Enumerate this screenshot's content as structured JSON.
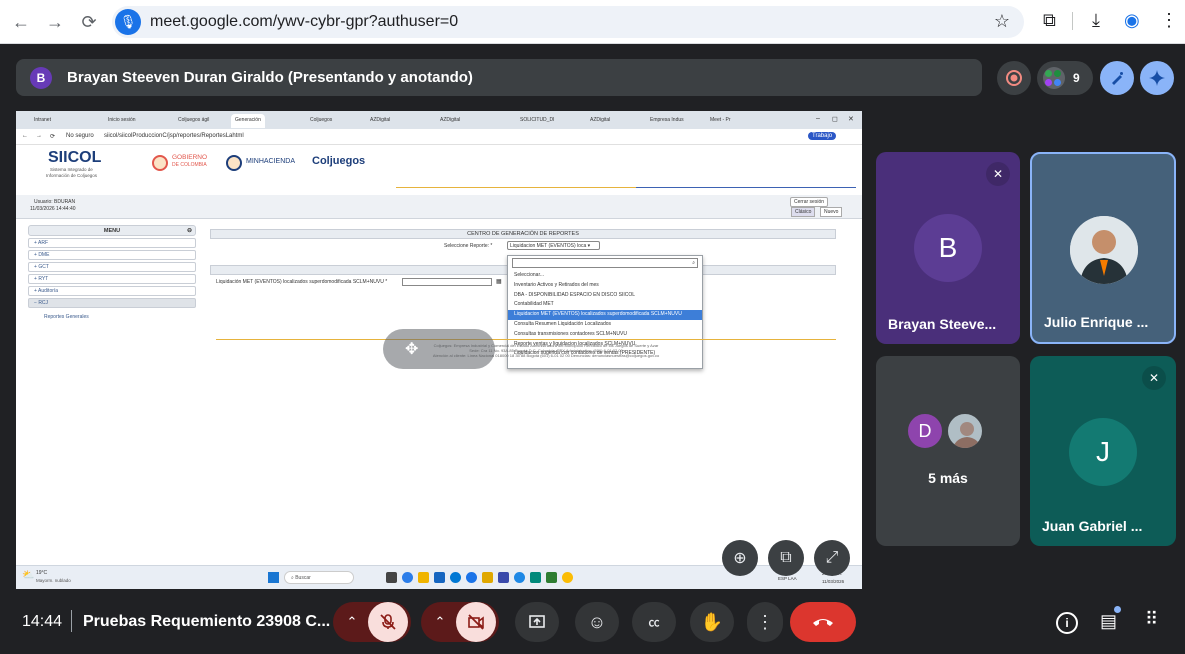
{
  "browser": {
    "url": "meet.google.com/ywv-cybr-gpr?authuser=0"
  },
  "meet": {
    "presenter_initial": "B",
    "presenter_title": "Brayan Steeven Duran Giraldo (Presentando y anotando)",
    "participant_count": "9",
    "time": "14:44",
    "meeting_name": "Pruebas Requemiento 23908 C..."
  },
  "tiles": [
    {
      "initial": "B",
      "name": "Brayan Steeve...",
      "color": "#4a2f7a"
    },
    {
      "name": "Julio Enrique ...",
      "color": "#45617a"
    },
    {
      "initial": "D",
      "name": "5 más",
      "color": "#3c4043"
    },
    {
      "initial": "J",
      "name": "Juan Gabriel ...",
      "color": "#0d5c57"
    }
  ],
  "shared": {
    "tabs": [
      "Intranet",
      "Inicio sesión",
      "Coljuegos ágil",
      "Generación",
      "Coljuegos",
      "AZDigital",
      "AZDigital",
      "SOLICITUD_DI",
      "AZDigital",
      "Empresa Indus",
      "Meet - Pr"
    ],
    "not_secure": "No seguro",
    "inner_url": "siicol/siicolProduccionC/jsp/reportes/ReportesLahtml",
    "profile": "Trabajo",
    "siicol_title": "SIICOL",
    "siicol_sub1": "Sistema Integrado de",
    "siicol_sub2": "Información de Coljuegos",
    "gobierno1": "GOBIERNO",
    "gobierno2": "DE COLOMBIA",
    "minhacienda": "MINHACIENDA",
    "coljuegos": "Coljuegos",
    "user_label": "Usuario: BDURAN",
    "user_date": "11/03/2026 14:44:40",
    "logout": "Cerrar sesión",
    "theme_classic": "Clásico",
    "theme_new": "Nuevo",
    "menu_title": "MENU",
    "menu_items": [
      "ARF",
      "DME",
      "GCT",
      "RYT",
      "Auditoría",
      "RCJ"
    ],
    "menu_sub": "Reportes Generales",
    "center_title": "CENTRO DE GENERACIÓN DE REPORTES",
    "select_label": "Seleccione Reporte: *",
    "select_value": "Liquidacion MET (EVENTOS) loca",
    "ingreso_title": "INGRESO",
    "field_label": "Liquidación MET (EVENTOS) localizados superdomodificada SCLM+NUVU *",
    "options": [
      "Seleccionar...",
      "Inventario Activos y Retirados del mes",
      "DBA - DISPONIBILIDAD ESPACIO EN DISCO SIICOL",
      "Contabilidad MET",
      "Liquidacion MET (EVENTOS) localizados superdomodificada SCLM+NUVU",
      "Consulta Resumen Liquidación Localizados",
      "Consultas transmisiones contadores SCLM+NUVU",
      "Reporte ventas y liquidacion localizados SCLM+NUVU",
      "Liquidacion sugerida con contadores de ventas (PRESIDENTE)"
    ],
    "selected_index": 4,
    "footer1": "Coljuegos: Empresa Industrial y Comercial del Estado Administradora del Monopolio Rentístico de los Juegos de Suerte y Azar",
    "footer2": "Sede: Cra 11 No. 93A-85 Bogotá D.C. Colombia. PBX Administrativo: (601) 6-01 02 00",
    "footer3": "Atención al cliente: Línea Nacional 018000 18 35 88 Bogotá (601) 6-01 02 00 Denuncias: denunciasnuestras@coljuegos.gov.co",
    "weather_temp": "19°C",
    "weather_desc": "Mayorm. nublado",
    "search": "Buscar",
    "clock_time": "2:44 p. m.",
    "clock_date": "11/03/2026",
    "lang": "ESP LAA"
  },
  "icons": {
    "back": "back-arrow-icon",
    "forward": "forward-arrow-icon",
    "reload": "reload-icon",
    "mic_off": "mic-off-icon",
    "cam_off": "camera-off-icon",
    "present": "present-icon",
    "emoji": "emoji-icon",
    "cc": "captions-icon",
    "hand": "raise-hand-icon",
    "more": "more-options-icon",
    "hangup": "hangup-icon",
    "info": "info-icon",
    "chat": "chat-icon",
    "apps": "activities-icon"
  }
}
